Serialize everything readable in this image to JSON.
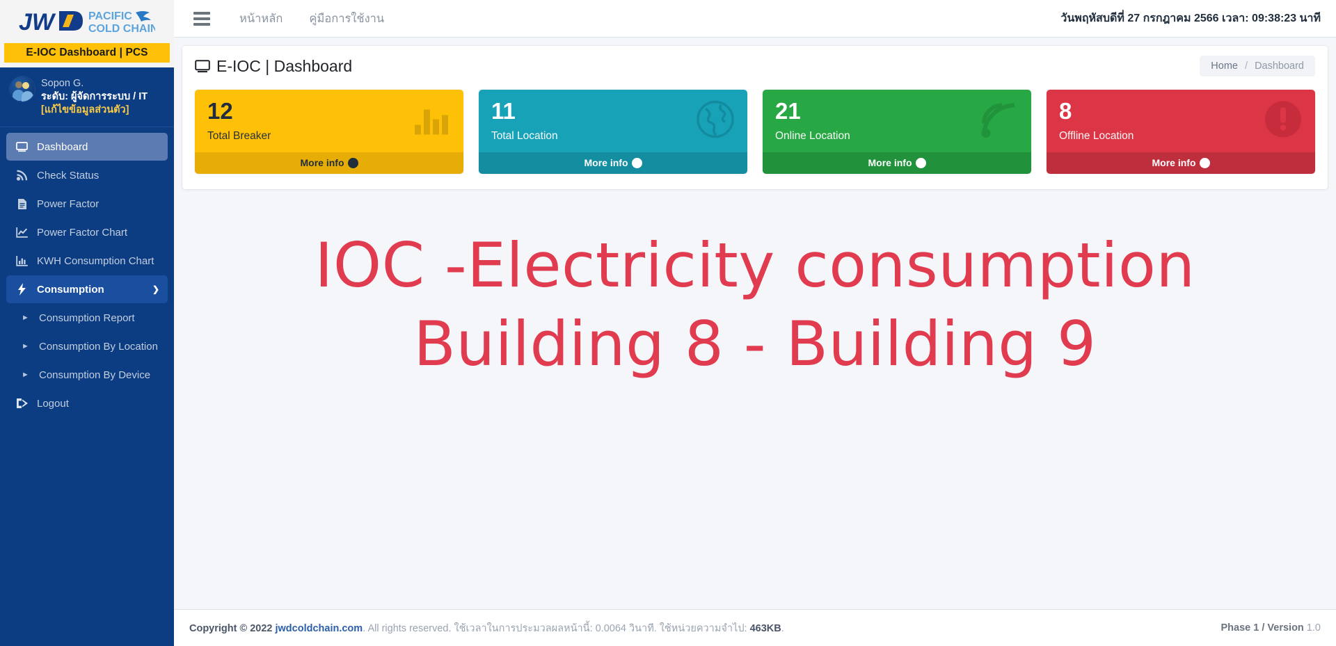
{
  "brand": {
    "logo_text_1": "JWD",
    "logo_text_2": "PACIFIC",
    "logo_text_3": "COLD CHAIN",
    "badge": "E-IOC Dashboard | PCS",
    "badge_color": "#ffc107",
    "sidebar_color": "#0c3c82"
  },
  "user": {
    "name": "Sopon G.",
    "role": "ระดับ: ผู้จัดการระบบ / IT",
    "edit_profile": "[แก้ไขข้อมูลส่วนตัว]"
  },
  "sidebar": {
    "items": [
      {
        "label": "Dashboard",
        "icon": "monitor-icon",
        "state": "active-light"
      },
      {
        "label": "Check Status",
        "icon": "signal-icon",
        "state": ""
      },
      {
        "label": "Power Factor",
        "icon": "file-text-icon",
        "state": ""
      },
      {
        "label": "Power Factor Chart",
        "icon": "line-chart-icon",
        "state": ""
      },
      {
        "label": "KWH Consumption Chart",
        "icon": "bar-chart-icon",
        "state": ""
      },
      {
        "label": "Consumption",
        "icon": "bolt-icon",
        "state": "active-dark",
        "expanded": true,
        "chevron": "chevron-down-icon"
      }
    ],
    "sub_items": [
      {
        "label": "Consumption Report",
        "icon": "caret-right-icon"
      },
      {
        "label": "Consumption By Location",
        "icon": "caret-right-icon"
      },
      {
        "label": "Consumption By Device",
        "icon": "caret-right-icon"
      }
    ],
    "logout": {
      "label": "Logout",
      "icon": "logout-icon"
    }
  },
  "navbar": {
    "menu_icon": "hamburger-icon",
    "links": [
      "หน้าหลัก",
      "คู่มือการใช้งาน"
    ],
    "datetime": "วันพฤหัสบดีที่ 27 กรกฎาคม 2566 เวลา: 09:38:23 นาที"
  },
  "page": {
    "title": "E-IOC | Dashboard",
    "title_icon": "monitor-icon",
    "breadcrumb": {
      "home": "Home",
      "separator": "/",
      "current": "Dashboard"
    }
  },
  "cards": [
    {
      "value": "12",
      "label": "Total Breaker",
      "more": "More info",
      "icon": "bar-chart-icon",
      "color": "#ffc107",
      "theme": "yellow"
    },
    {
      "value": "11",
      "label": "Total Location",
      "more": "More info",
      "icon": "globe-icon",
      "color": "#17a2b8",
      "theme": "cyan"
    },
    {
      "value": "21",
      "label": "Online Location",
      "more": "More info",
      "icon": "wifi-icon",
      "color": "#28a745",
      "theme": "green"
    },
    {
      "value": "8",
      "label": "Offline Location",
      "more": "More info",
      "icon": "exclamation-circle-icon",
      "color": "#dc3545",
      "theme": "red"
    }
  ],
  "hero": {
    "line1": "IOC -Electricity consumption",
    "line2": "Building 8 - Building 9",
    "color": "#e03b4e"
  },
  "footer": {
    "copyright_prefix": "Copyright © 2022",
    "site": "jwdcoldchain.com",
    "rights": ". All rights reserved. ใช้เวลาในการประมวลผลหน้านี้: 0.0064 วินาที. ใช้หน่วยความจำไป:",
    "memory": "463KB",
    "memory_suffix": ".",
    "right_bold": "Phase 1 / Version",
    "right_version": "1.0"
  }
}
